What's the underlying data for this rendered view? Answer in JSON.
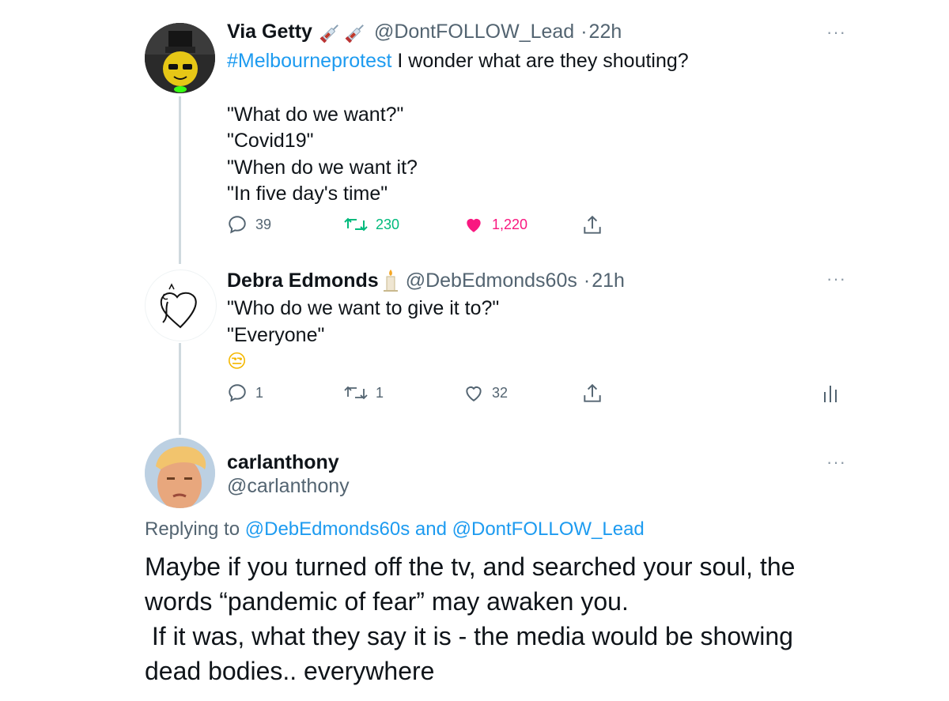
{
  "tweet1": {
    "name": "Via Getty",
    "handle": "@DontFOLLOW_Lead",
    "time": "22h",
    "hashtag": "#Melbourneprotest",
    "text_rest": " I wonder what are they shouting?",
    "lines": [
      "\"What do we want?\"",
      "\"Covid19\"",
      "\"When do we want it?",
      "\"In five day's time\""
    ],
    "replies": "39",
    "retweets": "230",
    "likes": "1,220",
    "liked": true,
    "retweeted": true,
    "colors": {
      "retweet": "#00ba7c",
      "like": "#f91880"
    }
  },
  "tweet2": {
    "name": "Debra Edmonds",
    "handle": "@DebEdmonds60s",
    "time": "21h",
    "lines": [
      "\"Who do we want to give it to?\"",
      "\"Everyone\""
    ],
    "emoji": "😒",
    "replies": "1",
    "retweets": "1",
    "likes": "32"
  },
  "tweet3": {
    "name": "carlanthony",
    "handle": "@carlanthony",
    "replying_prefix": "Replying to ",
    "mention1": "@DebEdmonds60s",
    "and": " and ",
    "mention2": "@DontFOLLOW_Lead",
    "lines": [
      "Maybe if you turned off the tv, and searched your soul, the",
      "words “pandemic of fear” may awaken you.",
      " If it was, what they say it is - the media would be showing",
      "dead bodies.. everywhere"
    ]
  },
  "ui": {
    "more_glyph": "···",
    "separator": "·",
    "accent": "#1d9bf0",
    "icons": [
      "reply-icon",
      "retweet-icon",
      "like-icon",
      "share-icon",
      "analytics-icon",
      "syringe-icon",
      "candle-icon",
      "more-icon"
    ]
  }
}
